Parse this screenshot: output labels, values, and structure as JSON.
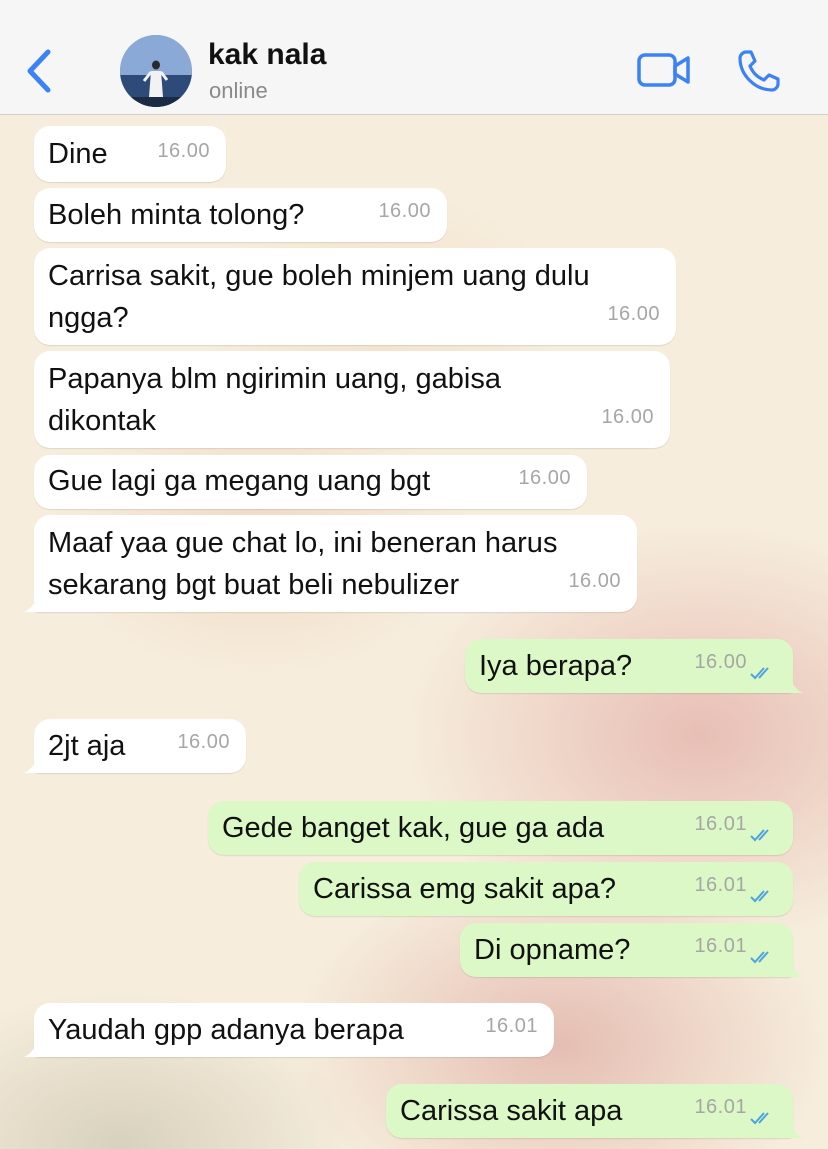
{
  "header": {
    "back_label": "",
    "contact_name": "kak nala",
    "status": "online",
    "icons": [
      "chevron-left-icon",
      "video-camera-icon",
      "phone-icon"
    ],
    "accent_color": "#3b82f6"
  },
  "messages": [
    {
      "direction": "incoming",
      "text": "Dine",
      "time": "16.00"
    },
    {
      "direction": "incoming",
      "text": "Boleh minta tolong?",
      "time": "16.00"
    },
    {
      "direction": "incoming",
      "text": "Carrisa sakit, gue boleh minjem uang dulu ngga?",
      "time": "16.00"
    },
    {
      "direction": "incoming",
      "text": "Papanya blm ngirimin uang, gabisa dikontak",
      "time": "16.00"
    },
    {
      "direction": "incoming",
      "text": "Gue lagi ga megang uang bgt",
      "time": "16.00"
    },
    {
      "direction": "incoming",
      "text": "Maaf yaa gue chat lo, ini beneran harus sekarang bgt buat beli nebulizer",
      "time": "16.00"
    },
    {
      "direction": "outgoing",
      "text": "Iya berapa?",
      "time": "16.00",
      "status": "read"
    },
    {
      "direction": "incoming",
      "text": "2jt aja",
      "time": "16.00"
    },
    {
      "direction": "outgoing",
      "text": "Gede banget kak, gue ga ada",
      "time": "16.01",
      "status": "read"
    },
    {
      "direction": "outgoing",
      "text": "Carissa emg sakit apa?",
      "time": "16.01",
      "status": "read"
    },
    {
      "direction": "outgoing",
      "text": "Di opname?",
      "time": "16.01",
      "status": "read"
    },
    {
      "direction": "incoming",
      "text": "Yaudah gpp adanya berapa",
      "time": "16.01"
    },
    {
      "direction": "outgoing",
      "text": "Carissa sakit apa",
      "time": "16.01",
      "status": "read"
    }
  ],
  "colors": {
    "incoming_bubble": "#ffffff",
    "outgoing_bubble": "#dcf8c6",
    "read_ticks": "#4fa3e0"
  }
}
